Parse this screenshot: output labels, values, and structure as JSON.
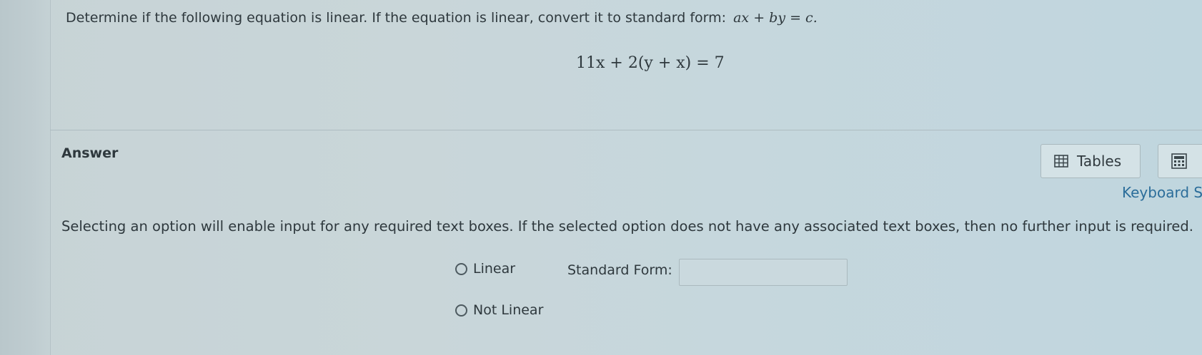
{
  "question": {
    "prompt_text": "Determine if the following equation is linear. If the equation is linear, convert it to standard form:",
    "standard_form_math": "ax + by = c.",
    "equation": "11x + 2(y + x) = 7"
  },
  "answer": {
    "label": "Answer",
    "tables_button_label": "Tables",
    "keyboard_link": "Keyboard S",
    "instructions": "Selecting an option will enable input for any required text boxes. If the selected option does not have any associated text boxes, then no further input is required.",
    "options": [
      {
        "label": "Linear"
      },
      {
        "label": "Not Linear"
      }
    ],
    "standard_form_label": "Standard Form:",
    "standard_form_value": "",
    "standard_form_placeholder": ""
  },
  "icons": {
    "tables": "table-icon",
    "calculator": "calculator-icon"
  },
  "colors": {
    "link": "#2b6d9a",
    "panel_bg": "#c6d7dd"
  }
}
